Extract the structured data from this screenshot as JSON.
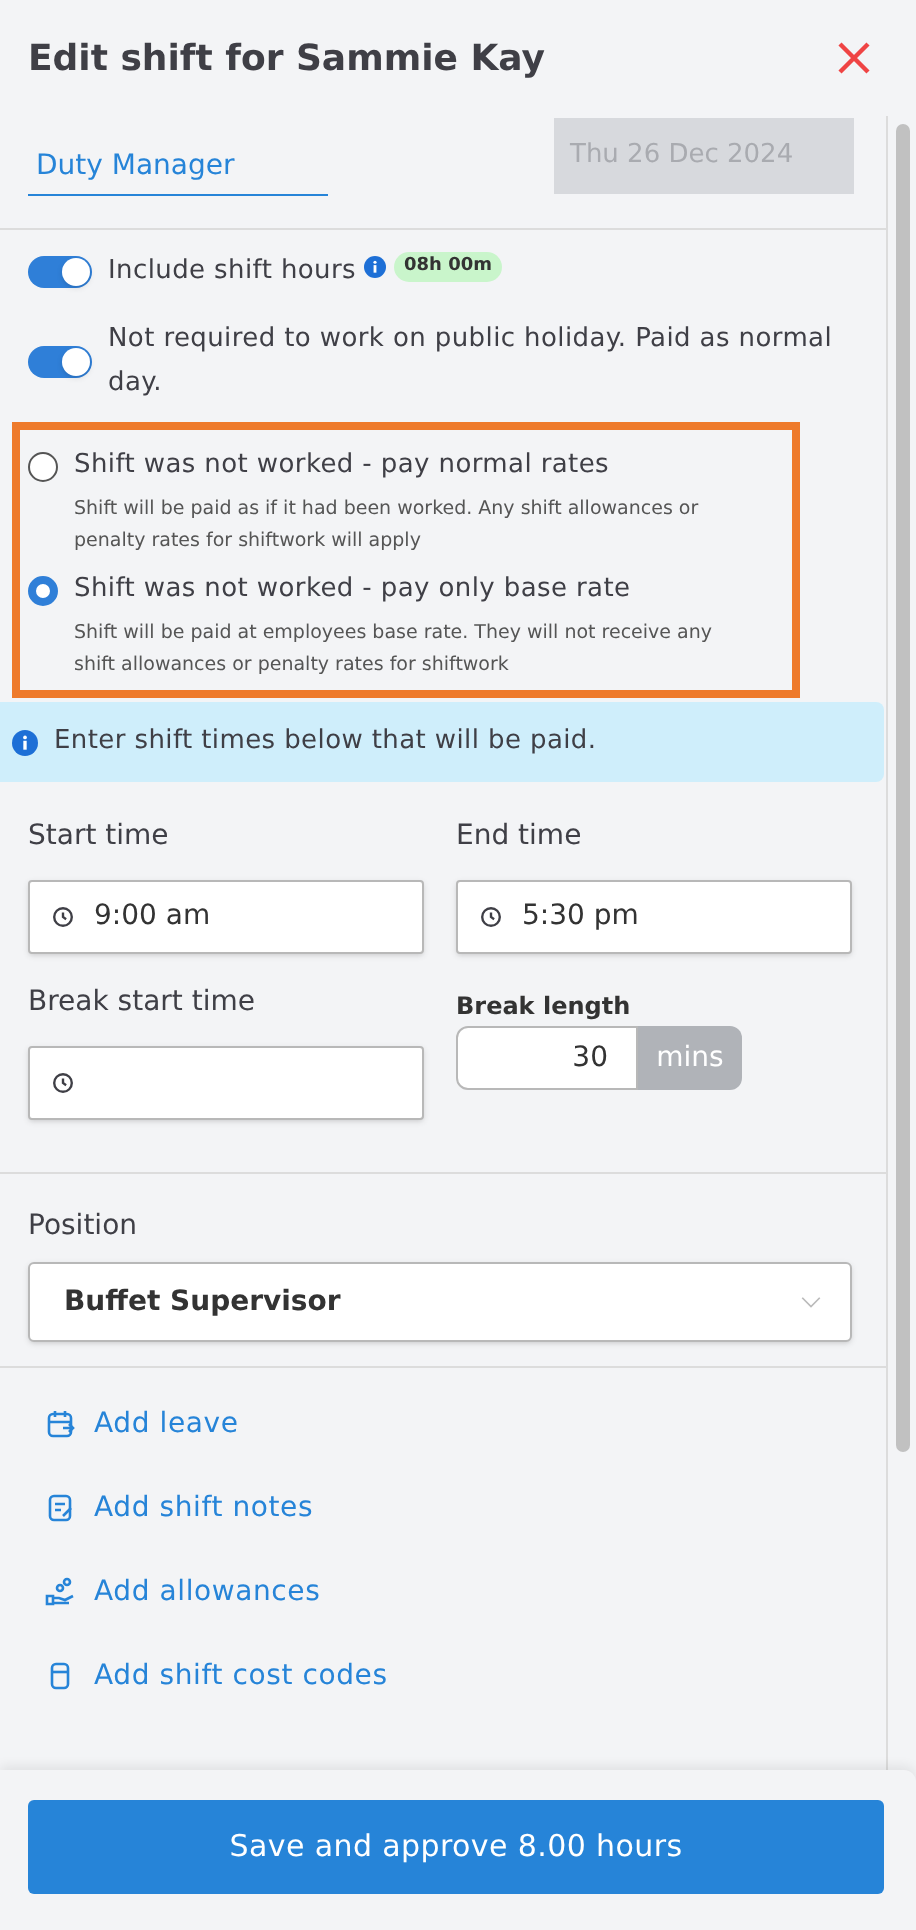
{
  "title": "Edit shift for Sammie Kay",
  "tabs": [
    {
      "label": "Duty Manager",
      "selected": true
    }
  ],
  "date_field": {
    "value": "Thu 26 Dec 2024",
    "disabled": true
  },
  "toggles": [
    {
      "label": "Include shift hours",
      "on": true,
      "info": true,
      "badge": "08h 00m"
    },
    {
      "label": "Not required to work on public holiday. Paid as normal day.",
      "on": true,
      "info": false
    }
  ],
  "pay_options": [
    {
      "label": "Shift was not worked - pay normal rates",
      "description": "Shift will be paid as if it had been worked. Any shift allowances or penalty rates for shiftwork will apply",
      "selected": false
    },
    {
      "label": "Shift was not worked - pay only base rate",
      "description": "Shift will be paid at employees base rate. They will not receive any shift allowances or penalty rates for shiftwork",
      "selected": true
    }
  ],
  "notice": "Enter shift times below that will be paid.",
  "start_time": {
    "label": "Start time",
    "value": "9:00 am"
  },
  "end_time": {
    "label": "End time",
    "value": "5:30 pm"
  },
  "break_start": {
    "label": "Break start time"
  },
  "break_length": {
    "label": "Break length",
    "value": "30",
    "unit": "mins"
  },
  "position": {
    "label": "Position",
    "value": "Buffet Supervisor"
  },
  "actions": [
    {
      "label": "Add leave",
      "kind": "leave"
    },
    {
      "label": "Add shift notes",
      "kind": "notes"
    },
    {
      "label": "Add allowances",
      "kind": "allowances"
    },
    {
      "label": "Add shift cost codes",
      "kind": "codes"
    }
  ],
  "save_button": "Save and approve 8.00 hours"
}
